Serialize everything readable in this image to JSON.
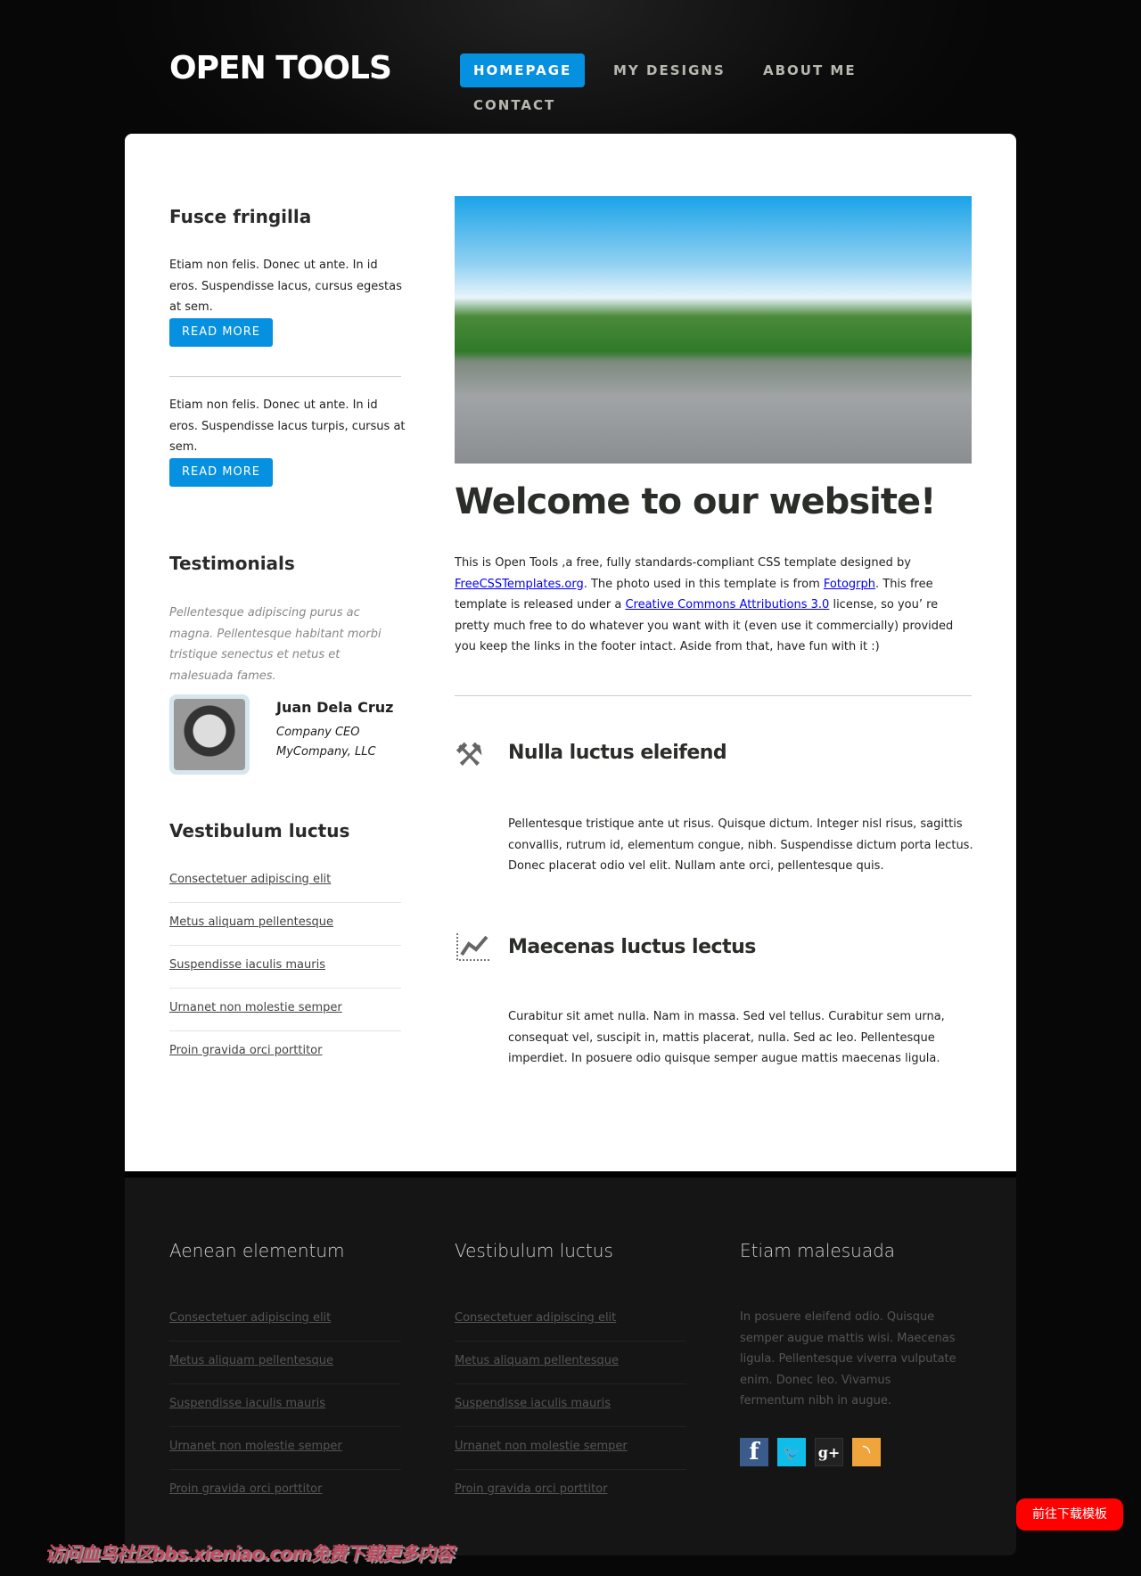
{
  "header": {
    "logo": "OPEN TOOLS",
    "nav": [
      {
        "label": "HOMEPAGE",
        "active": true
      },
      {
        "label": "MY DESIGNS"
      },
      {
        "label": "ABOUT ME"
      },
      {
        "label": "CONTACT"
      }
    ]
  },
  "sidebar": {
    "box1": {
      "title": "Fusce fringilla",
      "text1": "Etiam non felis. Donec ut ante. In id eros. Suspendisse lacus, cursus egestas at sem.",
      "button1": "READ MORE",
      "text2": "Etiam non felis. Donec ut ante. In id eros. Suspendisse lacus turpis, cursus at sem.",
      "button2": "READ MORE"
    },
    "testimonials": {
      "title": "Testimonials",
      "quote": "Pellentesque adipiscing purus ac magna. Pellentesque habitant morbi tristique senectus et netus et malesuada fames.",
      "name": "Juan Dela Cruz",
      "role": "Company CEO",
      "company": "MyCompany, LLC"
    },
    "links": {
      "title": "Vestibulum luctus",
      "items": [
        "Consectetuer adipiscing elit",
        "Metus aliquam pellentesque",
        "Suspendisse iaculis mauris",
        "Urnanet non molestie semper",
        "Proin gravida orci porttitor"
      ]
    }
  },
  "main": {
    "title": "Welcome to our website!",
    "intro": {
      "p1": "This is Open Tools ,a free, fully standards-compliant CSS template designed by ",
      "link1": "FreeCSSTemplates.org",
      "p2": ". The photo used in this template is from ",
      "link2": "Fotogrph",
      "p3": ". This free template is released under a ",
      "link3": "Creative Commons Attributions 3.0",
      "p4": " license, so you’ re pretty much free to do whatever you want with it (even use it commercially) provided you keep the links in the footer intact. Aside from that, have fun with it :)"
    },
    "features": [
      {
        "icon": "tools-icon",
        "title": "Nulla luctus eleifend",
        "text": "Pellentesque tristique ante ut risus. Quisque dictum. Integer nisl risus, sagittis convallis, rutrum id, elementum congue, nibh. Suspendisse dictum porta lectus. Donec placerat odio vel elit. Nullam ante orci, pellentesque quis."
      },
      {
        "icon": "chart-icon",
        "title": "Maecenas luctus lectus",
        "text": "Curabitur sit amet nulla. Nam in massa. Sed vel tellus. Curabitur sem urna, consequat vel, suscipit in, mattis placerat, nulla. Sed ac leo. Pellentesque imperdiet. In posuere odio quisque semper augue mattis maecenas ligula."
      }
    ]
  },
  "footer": {
    "col1": {
      "title": "Aenean elementum",
      "items": [
        "Consectetuer adipiscing elit",
        "Metus aliquam pellentesque",
        "Suspendisse iaculis mauris",
        "Urnanet non molestie semper",
        "Proin gravida orci porttitor"
      ]
    },
    "col2": {
      "title": "Vestibulum luctus",
      "items": [
        "Consectetuer adipiscing elit",
        "Metus aliquam pellentesque",
        "Suspendisse iaculis mauris",
        "Urnanet non molestie semper",
        "Proin gravida orci porttitor"
      ]
    },
    "col3": {
      "title": "Etiam malesuada",
      "text": "In posuere eleifend odio. Quisque semper augue mattis wisi. Maecenas ligula. Pellentesque viverra vulputate enim. Donec leo. Vivamus fermentum nibh in augue.",
      "social": [
        {
          "icon": "facebook-icon",
          "glyph": "f",
          "color": "#3b5b8a"
        },
        {
          "icon": "twitter-icon",
          "glyph": "🐦",
          "color": "#10bde9"
        },
        {
          "icon": "google-plus-icon",
          "glyph": "g+",
          "color": "#222222"
        },
        {
          "icon": "rss-icon",
          "glyph": "◝",
          "color": "#f0a43c"
        }
      ]
    }
  },
  "download_button": "前往下载模板",
  "watermark": "访问血鸟社区bbs.xieniao.com免费下载更多内容",
  "colors": {
    "accent": "#0690e0",
    "download": "#ff0000"
  }
}
